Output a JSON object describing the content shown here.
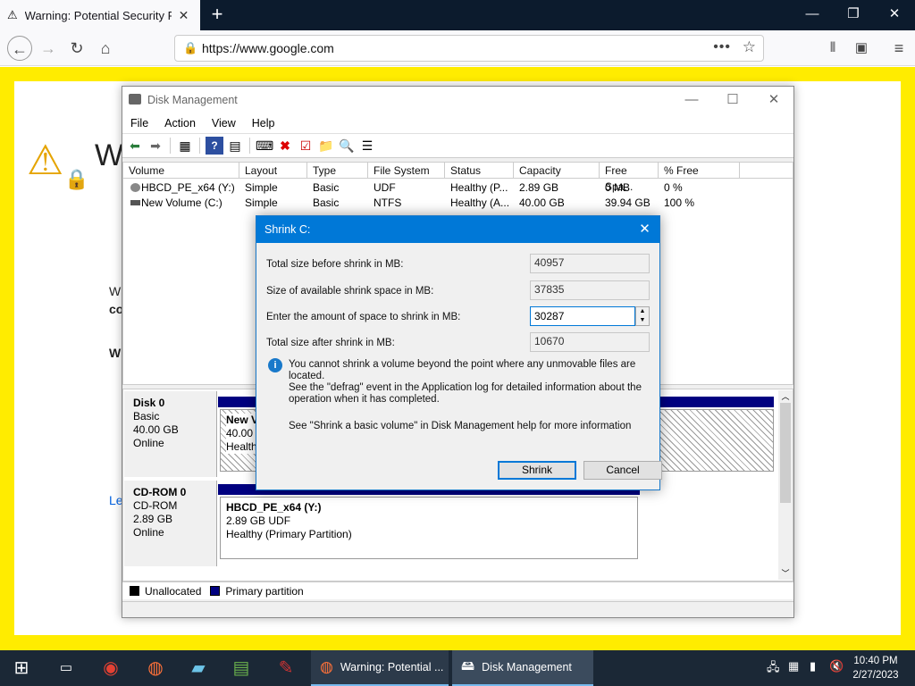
{
  "browser": {
    "tab_title": "Warning: Potential Security Risk Ahead",
    "tab_title_shown": "Warning: Potential Security Ris",
    "url": "https://www.google.com"
  },
  "error_page": {
    "heading_fragment": "W",
    "line1_fragment": "W",
    "line2_fragment": "co",
    "line3_fragment": "W",
    "link_fragment": "Le"
  },
  "disk_mgmt": {
    "title": "Disk Management",
    "menu": [
      "File",
      "Action",
      "View",
      "Help"
    ],
    "columns": [
      "Volume",
      "Layout",
      "Type",
      "File System",
      "Status",
      "Capacity",
      "Free Spa...",
      "% Free"
    ],
    "volumes": [
      {
        "name": "HBCD_PE_x64 (Y:)",
        "layout": "Simple",
        "type": "Basic",
        "fs": "UDF",
        "status": "Healthy (P...",
        "capacity": "2.89 GB",
        "free": "0 MB",
        "pct": "0 %"
      },
      {
        "name": "New Volume (C:)",
        "layout": "Simple",
        "type": "Basic",
        "fs": "NTFS",
        "status": "Healthy (A...",
        "capacity": "40.00 GB",
        "free": "39.94 GB",
        "pct": "100 %"
      }
    ],
    "disk0": {
      "name": "Disk 0",
      "type": "Basic",
      "size": "40.00 GB",
      "state": "Online",
      "part_name": "New V",
      "part_size": "40.00 G",
      "part_status": "Health"
    },
    "cdrom0": {
      "name": "CD-ROM 0",
      "type": "CD-ROM",
      "size": "2.89 GB",
      "state": "Online",
      "part_name": "HBCD_PE_x64  (Y:)",
      "part_size": "2.89 GB UDF",
      "part_status": "Healthy (Primary Partition)"
    },
    "legend": {
      "unallocated": "Unallocated",
      "primary": "Primary partition"
    }
  },
  "dialog": {
    "title": "Shrink C:",
    "total_before_label": "Total size before shrink in MB:",
    "total_before_value": "40957",
    "available_label": "Size of available shrink space in MB:",
    "available_value": "37835",
    "enter_label": "Enter the amount of space to shrink in MB:",
    "enter_value": "30287",
    "after_label": "Total size after shrink in MB:",
    "after_value": "10670",
    "info_line1": "You cannot shrink a volume beyond the point where any unmovable files are located.",
    "info_line2": "See the \"defrag\" event in the Application log for detailed information about the",
    "info_line3": "operation when it has completed.",
    "help_text": "See \"Shrink a basic volume\" in Disk Management help for more information",
    "shrink_button": "Shrink",
    "cancel_button": "Cancel"
  },
  "taskbar": {
    "firefox_window": "Warning: Potential ...",
    "dm_window": "Disk Management",
    "time": "10:40 PM",
    "date": "2/27/2023"
  }
}
